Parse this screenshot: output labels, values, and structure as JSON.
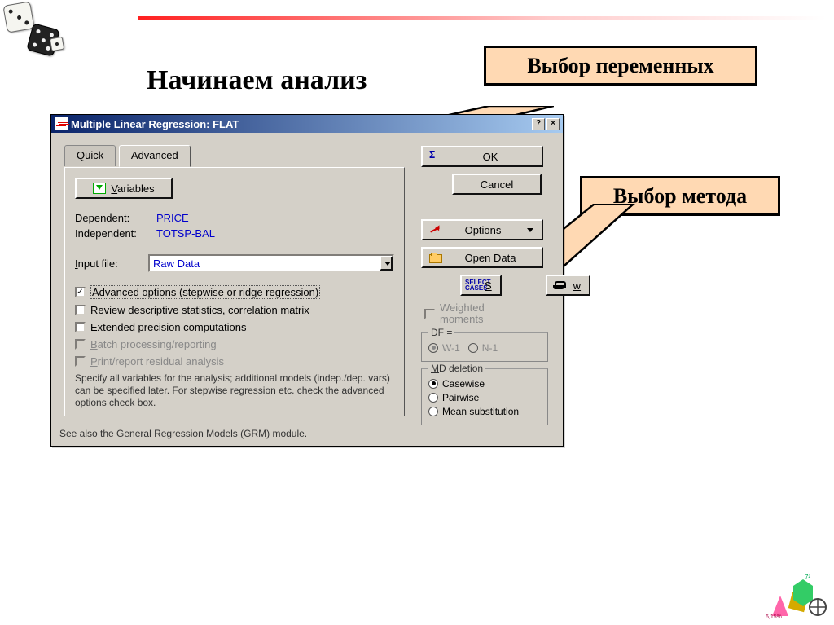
{
  "slide": {
    "title": "Начинаем анализ"
  },
  "callouts": {
    "c1": "Выбор переменных",
    "c2": "Выбор метода"
  },
  "window": {
    "title": "Multiple Linear Regression: FLAT",
    "tabs": {
      "quick": "Quick",
      "advanced": "Advanced"
    },
    "variables_button": "Variables",
    "dependent_label": "Dependent:",
    "dependent_value": "PRICE",
    "independent_label": "Independent:",
    "independent_value": "TOTSP-BAL",
    "input_file_label": "Input file:",
    "input_file_value": "Raw Data",
    "checkboxes": {
      "advanced": "Advanced options (stepwise or ridge regression)",
      "review": "Review descriptive statistics, correlation matrix",
      "extended": "Extended precision computations",
      "batch": "Batch processing/reporting",
      "print": "Print/report residual analysis"
    },
    "hint": "Specify all variables for the analysis; additional models (indep./dep. vars) can be specified later.  For stepwise regression etc. check the advanced options check box.",
    "footer": "See also the General Regression Models (GRM) module.",
    "right": {
      "ok": "OK",
      "cancel": "Cancel",
      "options": "Options",
      "open_data": "Open Data",
      "cases_s": "S",
      "cases_label": "SELECT\nCASES",
      "weight_w": "w",
      "weighted": "Weighted moments",
      "df_legend": "DF =",
      "df_w1": "W-1",
      "df_n1": "N-1",
      "md_legend": "MD deletion",
      "md_case": "Casewise",
      "md_pair": "Pairwise",
      "md_mean": "Mean substitution"
    }
  }
}
